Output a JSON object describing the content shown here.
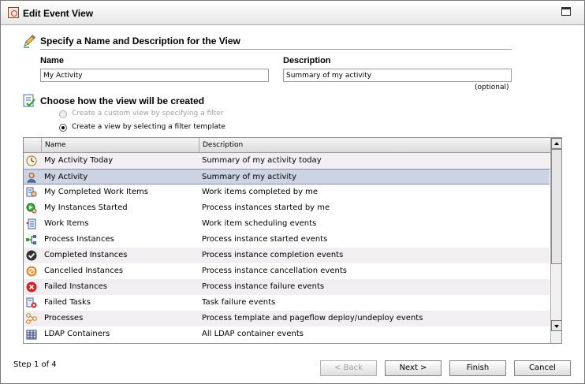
{
  "window": {
    "title": "Edit Event View"
  },
  "section1": {
    "title": "Specify a Name and Description for the View"
  },
  "name_field": {
    "label": "Name",
    "value": "My Activity"
  },
  "description_field": {
    "label": "Description",
    "value": "Summary of my activity",
    "hint": "(optional)"
  },
  "section2": {
    "title": "Choose how the view will be created"
  },
  "options": [
    {
      "label": "Create a custom view by specifying a filter",
      "selected": false,
      "enabled": false
    },
    {
      "label": "Create a view by selecting a filter template",
      "selected": true,
      "enabled": true
    }
  ],
  "table": {
    "columns": [
      "Name",
      "Description"
    ],
    "rows": [
      {
        "icon": "clock-icon",
        "name": "My Activity Today",
        "description": "Summary of my activity today"
      },
      {
        "icon": "user-icon",
        "name": "My Activity",
        "description": "Summary of my activity",
        "selected": true
      },
      {
        "icon": "completed-work-items-icon",
        "name": "My Completed Work Items",
        "description": "Work items completed by me"
      },
      {
        "icon": "instances-started-icon",
        "name": "My Instances Started",
        "description": "Process instances started by me"
      },
      {
        "icon": "work-items-icon",
        "name": "Work Items",
        "description": "Work item scheduling events"
      },
      {
        "icon": "process-instances-icon",
        "name": "Process Instances",
        "description": "Process instance started events"
      },
      {
        "icon": "check-circle-icon",
        "name": "Completed Instances",
        "description": "Process instance completion events"
      },
      {
        "icon": "cancel-circle-icon",
        "name": "Cancelled Instances",
        "description": "Process instance cancellation events"
      },
      {
        "icon": "error-x-icon",
        "name": "Failed Instances",
        "description": "Process instance failure events"
      },
      {
        "icon": "failed-tasks-icon",
        "name": "Failed Tasks",
        "description": "Task failure events"
      },
      {
        "icon": "processes-icon",
        "name": "Processes",
        "description": "Process template and pageflow deploy/undeploy events"
      },
      {
        "icon": "ldap-containers-icon",
        "name": "LDAP Containers",
        "description": "All LDAP container events"
      }
    ]
  },
  "footer": {
    "step": "Step 1 of 4",
    "back": "< Back",
    "next": "Next >",
    "finish": "Finish",
    "cancel": "Cancel"
  }
}
